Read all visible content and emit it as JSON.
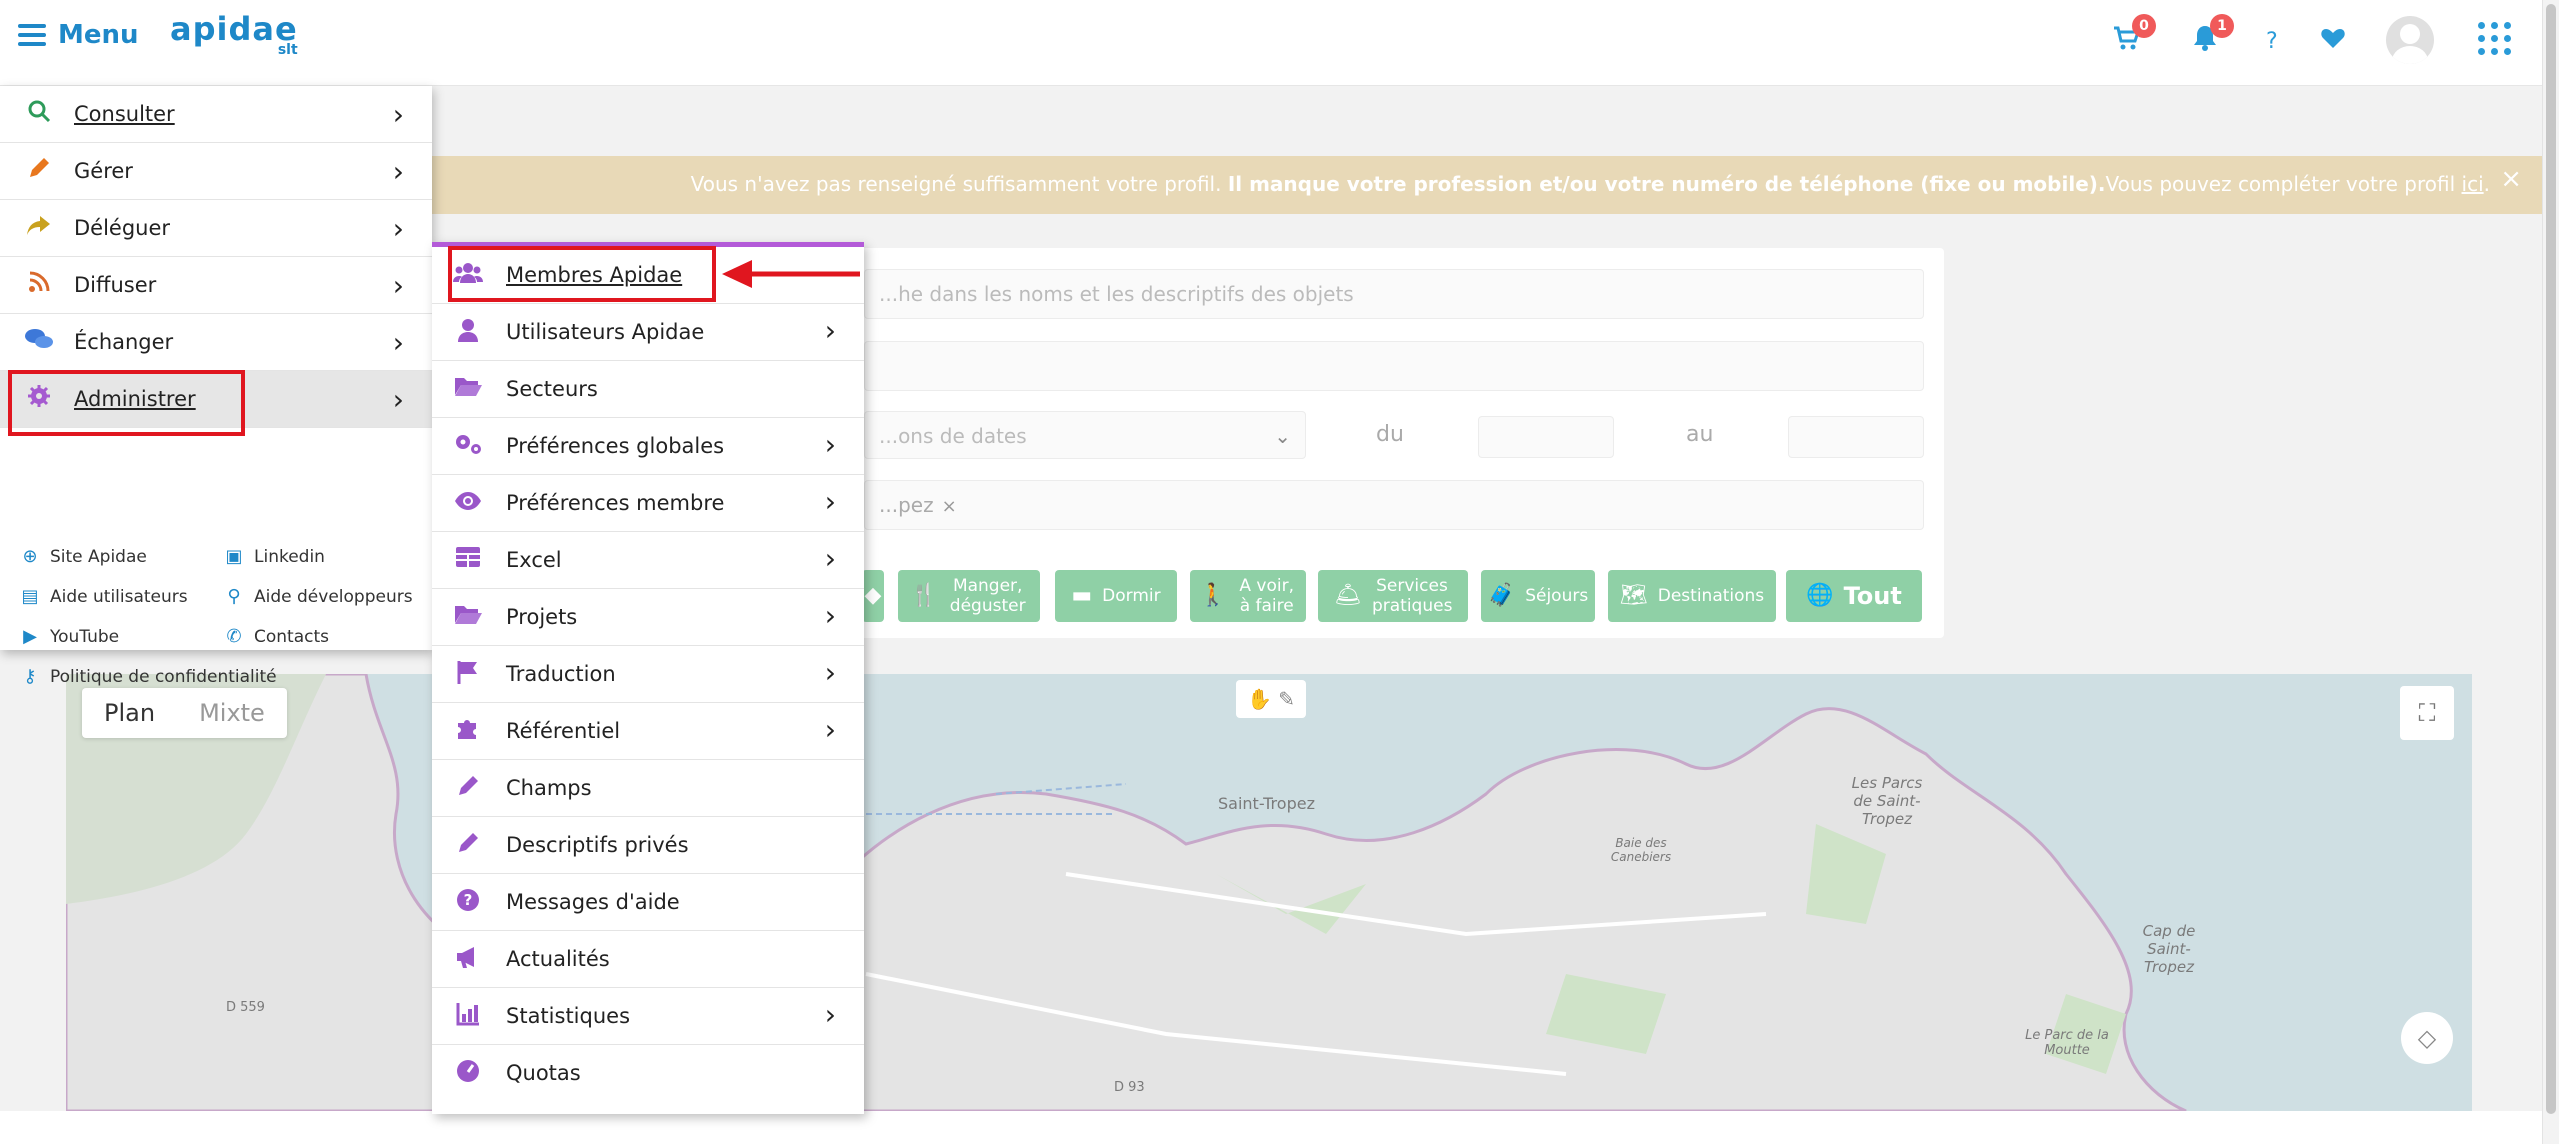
{
  "header": {
    "menu_label": "Menu",
    "logo_main": "apidae",
    "logo_sub": "slt",
    "cart_count": "0",
    "notifications_count": "1",
    "help_symbol": "?"
  },
  "alert": {
    "text_part1": "Vous n'avez pas renseigné suffisamment votre profil. ",
    "text_bold": "Il manque votre profession et/ou votre numéro de téléphone (fixe ou mobile).",
    "text_part2": "Vous pouvez compléter votre profil ",
    "link": "ici",
    "text_end": ".",
    "close": "×"
  },
  "search": {
    "keyword_placeholder": "...he dans les noms et les descriptifs des objets",
    "dates_select": "...ons de dates",
    "du_label": "du",
    "au_label": "au",
    "location_chip": "...pez"
  },
  "categories": [
    {
      "label": "",
      "icon": "fish-icon"
    },
    {
      "label": "Manger, déguster",
      "icon": "fork-knife-icon"
    },
    {
      "label": "Dormir",
      "icon": "bed-icon"
    },
    {
      "label": "A voir, à faire",
      "icon": "walking-icon"
    },
    {
      "label": "Services pratiques",
      "icon": "bell-icon"
    },
    {
      "label": "Séjours",
      "icon": "suitcase-icon"
    },
    {
      "label": "Destinations",
      "icon": "map-icon"
    },
    {
      "label": "Tout",
      "icon": "globe-icon"
    }
  ],
  "map": {
    "tab_plan": "Plan",
    "tab_mixte": "Mixte",
    "labels": [
      "Saint-Tropez",
      "Les Parcs de Saint-Tropez",
      "Cap de Saint-Tropez",
      "D 559",
      "D 93",
      "Le Parc de la Moutte",
      "Baie des Canebiers"
    ]
  },
  "menu": {
    "items": [
      {
        "label": "Consulter",
        "icon": "search-icon",
        "color": "#2e9b5a"
      },
      {
        "label": "Gérer",
        "icon": "pencil-icon",
        "color": "#e8771e"
      },
      {
        "label": "Déléguer",
        "icon": "share-icon",
        "color": "#c9a11e"
      },
      {
        "label": "Diffuser",
        "icon": "rss-icon",
        "color": "#d96a2c"
      },
      {
        "label": "Échanger",
        "icon": "chat-icon",
        "color": "#3d78d8"
      },
      {
        "label": "Administrer",
        "icon": "gear-icon",
        "color": "#a55ad0"
      }
    ],
    "links": [
      {
        "label": "Site Apidae",
        "icon": "globe-icon"
      },
      {
        "label": "Linkedin",
        "icon": "linkedin-icon"
      },
      {
        "label": "Aide utilisateurs",
        "icon": "book-icon"
      },
      {
        "label": "Aide développeurs",
        "icon": "search-icon"
      },
      {
        "label": "YouTube",
        "icon": "youtube-icon"
      },
      {
        "label": "Contacts",
        "icon": "phone-icon"
      },
      {
        "label": "Politique de confidentialité",
        "icon": "key-icon"
      }
    ]
  },
  "submenu": {
    "accent_color": "#b35ad8",
    "items": [
      {
        "label": "Membres Apidae",
        "icon": "users-icon",
        "has_children": false
      },
      {
        "label": "Utilisateurs Apidae",
        "icon": "user-icon",
        "has_children": true
      },
      {
        "label": "Secteurs",
        "icon": "folder-open-icon",
        "has_children": false
      },
      {
        "label": "Préférences globales",
        "icon": "gears-icon",
        "has_children": true
      },
      {
        "label": "Préférences membre",
        "icon": "eye-icon",
        "has_children": true
      },
      {
        "label": "Excel",
        "icon": "table-icon",
        "has_children": true
      },
      {
        "label": "Projets",
        "icon": "folder-open-icon",
        "has_children": true
      },
      {
        "label": "Traduction",
        "icon": "flag-icon",
        "has_children": true
      },
      {
        "label": "Référentiel",
        "icon": "puzzle-icon",
        "has_children": true
      },
      {
        "label": "Champs",
        "icon": "pencil-icon",
        "has_children": false
      },
      {
        "label": "Descriptifs privés",
        "icon": "pencil-icon",
        "has_children": false
      },
      {
        "label": "Messages d'aide",
        "icon": "question-icon",
        "has_children": false
      },
      {
        "label": "Actualités",
        "icon": "megaphone-icon",
        "has_children": false
      },
      {
        "label": "Statistiques",
        "icon": "chart-icon",
        "has_children": true
      },
      {
        "label": "Quotas",
        "icon": "gauge-icon",
        "has_children": false
      }
    ]
  },
  "annotation_color": "#e0161f"
}
